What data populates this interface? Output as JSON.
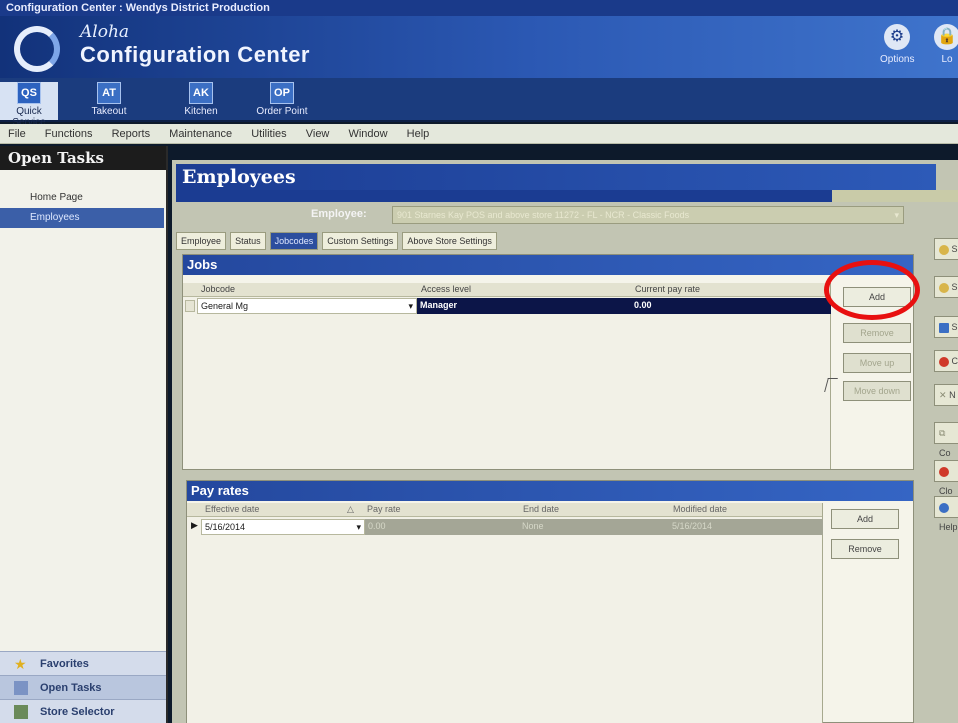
{
  "window": {
    "title": "Configuration Center : Wendys District Production"
  },
  "header": {
    "logo_script": "Aloha",
    "app_title": "Configuration Center",
    "options_label": "Options",
    "logout_label": "Lo"
  },
  "modules": [
    {
      "badge": "QS",
      "label": "Quick Service"
    },
    {
      "badge": "AT",
      "label": "Takeout"
    },
    {
      "badge": "AK",
      "label": "Kitchen"
    },
    {
      "badge": "OP",
      "label": "Order Point"
    }
  ],
  "menubar": [
    "File",
    "Functions",
    "Reports",
    "Maintenance",
    "Utilities",
    "View",
    "Window",
    "Help"
  ],
  "left_panel": {
    "header": "Open Tasks",
    "items": [
      "Home Page",
      "Employees"
    ],
    "bottom": [
      "Favorites",
      "Open Tasks",
      "Store Selector"
    ]
  },
  "employees": {
    "title": "Employees",
    "employee_label": "Employee:",
    "employee_value": "901 Starnes Kay POS and above store 11272 - FL - NCR - Classic Foods",
    "subtabs": [
      "Employee",
      "Status",
      "Jobcodes",
      "Custom Settings",
      "Above Store Settings"
    ],
    "active_subtab": "Jobcodes"
  },
  "jobs": {
    "title": "Jobs",
    "columns": [
      "Jobcode",
      "Access level",
      "Current pay rate"
    ],
    "rows": [
      {
        "jobcode": "General Mg",
        "access_level": "Manager",
        "pay_rate": "0.00"
      }
    ],
    "buttons": [
      "Add",
      "Remove",
      "Move up",
      "Move down"
    ]
  },
  "pay_rates": {
    "title": "Pay rates",
    "columns": [
      "Effective date",
      "Pay rate",
      "End date",
      "Modified date"
    ],
    "rows": [
      {
        "effective_date": "5/16/2014",
        "pay_rate": "0.00",
        "end_date": "None",
        "modified_date": "5/16/2014"
      }
    ],
    "buttons": [
      "Add",
      "Remove"
    ]
  },
  "right_rail": [
    "S",
    "S",
    "S",
    "C",
    "N",
    "Co",
    "Clo",
    "Help"
  ],
  "colors": {
    "header_blue": "#2b58b3",
    "selection_dark": "#0c1548",
    "highlight_red": "#e81010"
  }
}
